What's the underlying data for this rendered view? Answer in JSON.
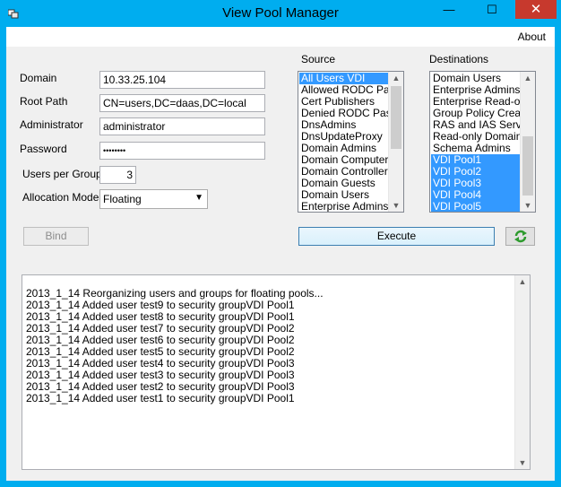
{
  "window": {
    "title": "View Pool Manager",
    "minimize_glyph": "—",
    "maximize_glyph": "☐",
    "close_glyph": "✕"
  },
  "menu": {
    "about": "About"
  },
  "form": {
    "domain_label": "Domain",
    "domain_value": "10.33.25.104",
    "root_label": "Root Path",
    "root_value": "CN=users,DC=daas,DC=local",
    "admin_label": "Administrator",
    "admin_value": "administrator",
    "password_label": "Password",
    "password_value": "••••••••",
    "users_label": "Users per Group",
    "users_value": "3",
    "allocation_label": "Allocation Model",
    "allocation_value": "Floating",
    "bind_label": "Bind"
  },
  "source": {
    "label": "Source",
    "items": [
      "All Users VDI",
      "Allowed RODC Pass",
      "Cert Publishers",
      "Denied RODC Passv",
      "DnsAdmins",
      "DnsUpdateProxy",
      "Domain Admins",
      "Domain Computers",
      "Domain Controllers",
      "Domain Guests",
      "Domain Users",
      "Enterprise Admins"
    ],
    "selected": [
      "All Users VDI"
    ]
  },
  "destinations": {
    "label": "Destinations",
    "items": [
      "Domain Users",
      "Enterprise Admins",
      "Enterprise Read-only",
      "Group Policy Creator",
      "RAS and IAS Server",
      "Read-only Domain C",
      "Schema Admins",
      "VDI Pool1",
      "VDI Pool2",
      "VDI Pool3",
      "VDI Pool4",
      "VDI Pool5"
    ],
    "selected": [
      "VDI Pool1",
      "VDI Pool2",
      "VDI Pool3",
      "VDI Pool4",
      "VDI Pool5"
    ]
  },
  "actions": {
    "execute_label": "Execute"
  },
  "log": {
    "lines": [
      "2013_1_14 Reorganizing users and groups for floating pools...",
      "2013_1_14 Added user test9 to security groupVDI Pool1",
      "2013_1_14 Added user test8 to security groupVDI Pool1",
      "2013_1_14 Added user test7 to security groupVDI Pool2",
      "2013_1_14 Added user test6 to security groupVDI Pool2",
      "2013_1_14 Added user test5 to security groupVDI Pool2",
      "2013_1_14 Added user test4 to security groupVDI Pool3",
      "2013_1_14 Added user test3 to security groupVDI Pool3",
      "2013_1_14 Added user test2 to security groupVDI Pool3",
      "2013_1_14 Added user test1 to security groupVDI Pool1"
    ]
  },
  "colors": {
    "frame": "#00adef",
    "selection": "#3399ff",
    "close": "#c7392d"
  }
}
